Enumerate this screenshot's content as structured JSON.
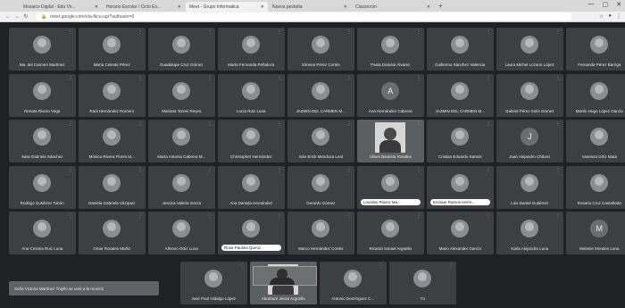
{
  "browser": {
    "tabs": [
      {
        "title": "Mosaico Digital - Edu Vir...",
        "active": false
      },
      {
        "title": "Horario Escolar / Ciclo Es...",
        "active": false
      },
      {
        "title": "Meet - Grupo Informatica",
        "active": true
      },
      {
        "title": "Nueva pestaña",
        "active": false
      },
      {
        "title": "Classroom",
        "active": false
      }
    ],
    "new_tab": "+",
    "url": "meet.google.com/vta-fkcu-ugr?authuser=0",
    "window_controls": {
      "minimize": "—",
      "maximize": "▢",
      "close": "✕"
    }
  },
  "meet": {
    "participants": [
      {
        "name": "Ma. del Carmen Martínez",
        "avatar": "photo"
      },
      {
        "name": "María Celeste Pérez",
        "avatar": "photo"
      },
      {
        "name": "Guadalupe Cruz Gómez",
        "avatar": "photo"
      },
      {
        "name": "María Fernanda Peñaloza",
        "avatar": "photo"
      },
      {
        "name": "Ximena Pérez Cortés",
        "avatar": "photo"
      },
      {
        "name": "Paola Daniela Álvarez",
        "avatar": "photo"
      },
      {
        "name": "Guillermo Sánchez Valencia",
        "avatar": "photo"
      },
      {
        "name": "Laura Michel Lozano López",
        "avatar": "photo"
      },
      {
        "name": "Fernanda Pérez Barriga",
        "avatar": "photo"
      },
      {
        "name": "Renata Rivero Vega",
        "avatar": "photo"
      },
      {
        "name": "Raúl Hernández Romero",
        "avatar": "photo"
      },
      {
        "name": "Mariana Torres Reyes",
        "avatar": "photo"
      },
      {
        "name": "Lucía Ruiz Luna",
        "avatar": "photo"
      },
      {
        "name": "JAZMIN DEL CARMEN M...",
        "avatar": "photo",
        "highlight": true
      },
      {
        "name": "Ana Hernández Cabrera",
        "avatar": "letter",
        "letter": "A"
      },
      {
        "name": "JAZMIN DEL CARMEN M...",
        "avatar": "photo"
      },
      {
        "name": "Gabriel Pérez Solís Gómez",
        "avatar": "photo"
      },
      {
        "name": "Martín Hugo López García",
        "avatar": "photo"
      },
      {
        "name": "Sara Gabriela Sánchez",
        "avatar": "photo"
      },
      {
        "name": "Mónica Rivera Flores M...",
        "avatar": "photo"
      },
      {
        "name": "María Antonia Cabrera M...",
        "avatar": "photo"
      },
      {
        "name": "Christopher Hernández",
        "avatar": "photo"
      },
      {
        "name": "Iván Erick Mendoza Leal",
        "avatar": "photo"
      },
      {
        "name": "Ulises Bautista Rosales",
        "avatar": "video"
      },
      {
        "name": "Cristian Eduardo Santos",
        "avatar": "photo"
      },
      {
        "name": "Juan Alejandro Chávez",
        "avatar": "letter",
        "letter": "J"
      },
      {
        "name": "Vanessa Ortiz Mata",
        "avatar": "photo"
      },
      {
        "name": "Rodrigo Gutiérrez Tobón",
        "avatar": "photo"
      },
      {
        "name": "Daniela Gabriela Vázquez",
        "avatar": "photo"
      },
      {
        "name": "Jessica Valeria Garza",
        "avatar": "photo"
      },
      {
        "name": "Ana Daniela Hernández",
        "avatar": "photo"
      },
      {
        "name": "Gerardo Gómez",
        "avatar": "photo"
      },
      {
        "name": "Lourdes Rivera Ma...",
        "avatar": "photo",
        "pill": true
      },
      {
        "name": "Enrique Ramos Herre...",
        "avatar": "photo",
        "pill": true
      },
      {
        "name": "Luis Daniel Gutiérrez",
        "avatar": "photo"
      },
      {
        "name": "Rosario Cruz Castañeda",
        "avatar": "photo"
      },
      {
        "name": "Ana Cristina Ruiz Luna",
        "avatar": "photo"
      },
      {
        "name": "Omar Rosales Muñiz",
        "avatar": "photo"
      },
      {
        "name": "Alfonso Ortiz Luna",
        "avatar": "photo"
      },
      {
        "name": "Rosa Paulina Quiroz",
        "avatar": "photo",
        "pill": true
      },
      {
        "name": "Marco Hernández Cortés",
        "avatar": "photo"
      },
      {
        "name": "Ricardo Ismael Argüello",
        "avatar": "photo"
      },
      {
        "name": "Mario Alexander García",
        "avatar": "photo"
      },
      {
        "name": "Karla Alejandra Luna",
        "avatar": "photo"
      },
      {
        "name": "Melanie Morales Luna",
        "avatar": "letter",
        "letter": "M"
      }
    ],
    "bottom_participants": [
      {
        "name": "José Paul Hidalgo López",
        "avatar": "photo"
      },
      {
        "name": "Abraham Jesús Argüello",
        "avatar": "video"
      },
      {
        "name": "Antonio Domínguez C...",
        "avatar": "photo"
      },
      {
        "name": "Tú",
        "avatar": "photo"
      }
    ],
    "notice": "Sofía Victoria Martínez Trujillo se unió a la reunión"
  }
}
